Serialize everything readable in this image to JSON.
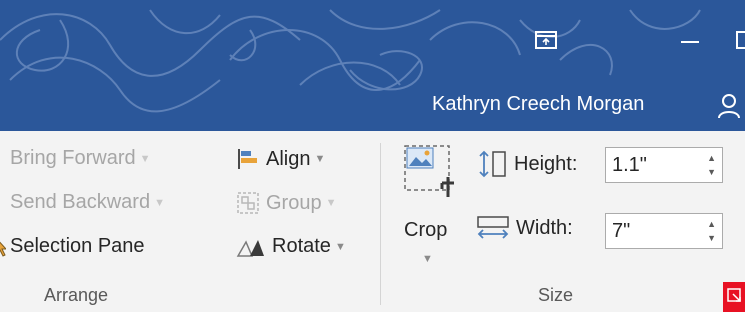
{
  "window": {
    "ribbon_display_icon": "ribbon-display-options-icon",
    "minimize_icon": "minimize-icon",
    "maximize_icon": "maximize-icon",
    "user_name": "Kathryn Creech Morgan",
    "share_icon": "share-person-icon",
    "title_bar_color": "#2b579a"
  },
  "arrange": {
    "bring_forward": "Bring Forward",
    "send_backward": "Send Backward",
    "selection_pane": "Selection Pane",
    "align": "Align",
    "group": "Group",
    "rotate": "Rotate",
    "label": "Arrange"
  },
  "size": {
    "crop": "Crop",
    "height_label": "Height:",
    "height_value": "1.1\"",
    "width_label": "Width:",
    "width_value": "7\"",
    "label": "Size",
    "launcher_highlight": "#e81123"
  }
}
